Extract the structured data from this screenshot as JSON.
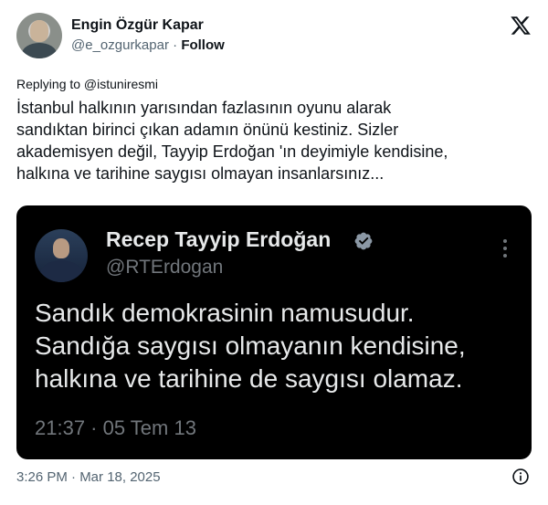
{
  "author": {
    "name": "Engin Özgür Kapar",
    "handle": "@e_ozgurkapar",
    "separator": "·",
    "follow_label": "Follow"
  },
  "reply": {
    "label": "Replying to @istuniresmi"
  },
  "tweet": {
    "lines": [
      "İstanbul halkının yarısından fazlasının oyunu alarak",
      "sandıktan birinci çıkan adamın önünü kestiniz. Sizler",
      "akademisyen değil, Tayyip Erdoğan 'ın deyimiyle kendisine,",
      "halkına ve tarihine saygısı olmayan insanlarsınız..."
    ],
    "timestamp": "3:26 PM · Mar 18, 2025"
  },
  "quoted": {
    "name": "Recep Tayyip Erdoğan",
    "handle": "@RTErdogan",
    "lines": [
      "Sandık demokrasinin namusudur.",
      "Sandığa saygısı olmayanın kendisine,",
      "halkına ve tarihine de saygısı olamaz."
    ],
    "time": "21:37 · 05 Tem 13"
  },
  "icons": {
    "logo": "x-logo-icon",
    "verified": "verified-badge-icon",
    "more": "more-options-icon",
    "info": "info-icon"
  },
  "colors": {
    "text": "#0f1419",
    "secondary": "#536471",
    "card_bg": "#000000",
    "card_text": "#e7e9ea",
    "card_secondary": "#71767b",
    "verified": "#1d9bf0"
  }
}
